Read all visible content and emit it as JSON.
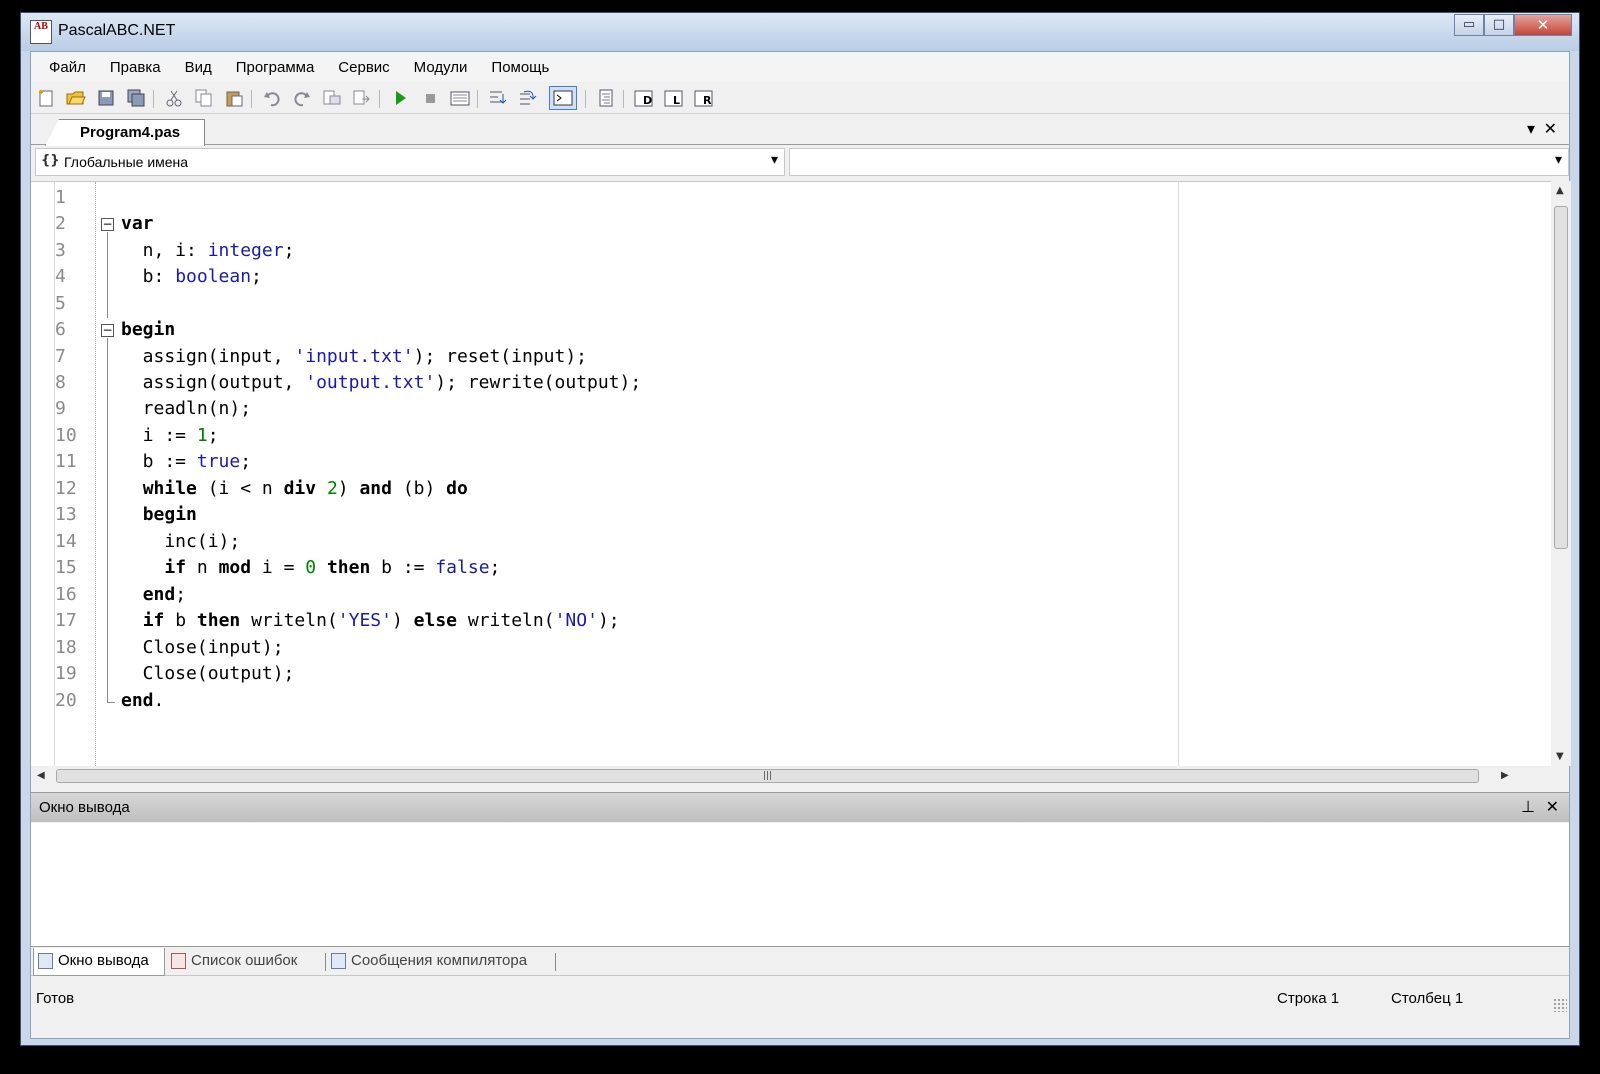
{
  "window": {
    "title": "PascalABC.NET",
    "icon_text": "AB",
    "controls": {
      "minimize": "▭",
      "maximize": "□",
      "close": "✕"
    }
  },
  "menu": [
    "Файл",
    "Правка",
    "Вид",
    "Программа",
    "Сервис",
    "Модули",
    "Помощь"
  ],
  "toolbar": {
    "icons": [
      "new-file-icon",
      "open-icon",
      "save-icon",
      "save-all-icon",
      "cut-icon",
      "copy-icon",
      "paste-icon",
      "undo-icon",
      "redo-icon",
      "find-icon",
      "replace-icon",
      "run-icon",
      "stop-icon",
      "compile-icon",
      "step-into-icon",
      "step-over-icon",
      "console-icon",
      "format-icon",
      "debug-d-icon",
      "debug-l-icon",
      "debug-r-icon"
    ]
  },
  "document_tab": {
    "label": "Program4.pas"
  },
  "nav": {
    "scope_label": "Глобальные имена",
    "member_label": ""
  },
  "code": {
    "line_numbers": [
      "1",
      "2",
      "3",
      "4",
      "5",
      "6",
      "7",
      "8",
      "9",
      "10",
      "11",
      "12",
      "13",
      "14",
      "15",
      "16",
      "17",
      "18",
      "19",
      "20"
    ]
  },
  "output_panel": {
    "title": "Окно вывода",
    "content": ""
  },
  "bottom_tabs": [
    "Окно вывода",
    "Список ошибок",
    "Сообщения компилятора"
  ],
  "status": {
    "state": "Готов",
    "row": "Строка 1",
    "col": "Столбец 1"
  },
  "colors": {
    "keyword": "#000000",
    "type": "#1a1aa6",
    "string": "#1a1aa6",
    "number": "#008000",
    "line_number": "#8a8a8a"
  }
}
